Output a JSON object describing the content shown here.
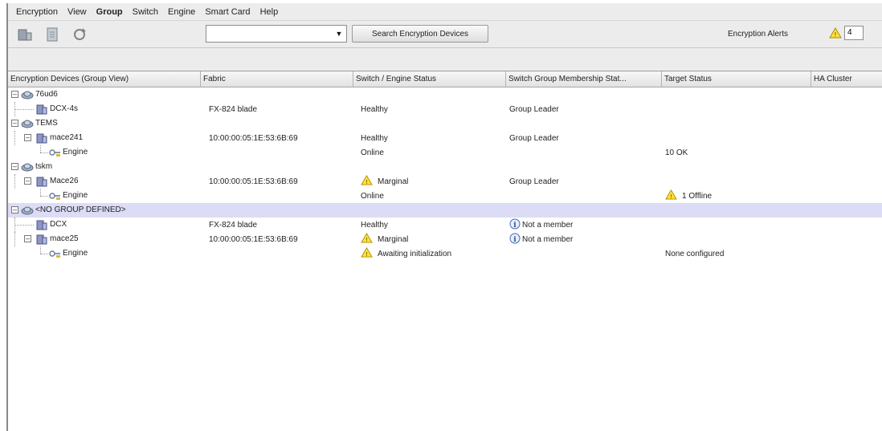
{
  "menu": [
    "Encryption",
    "View",
    "Group",
    "Switch",
    "Engine",
    "Smart Card",
    "Help"
  ],
  "search": {
    "value": "",
    "button_label": "Search Encryption Devices"
  },
  "alerts": {
    "label": "Encryption Alerts",
    "count": "4"
  },
  "columns": [
    "Encryption Devices (Group View)",
    "Fabric",
    "Switch / Engine Status",
    "Switch Group Membership Stat...",
    "Target Status",
    "HA Cluster"
  ],
  "rows": [
    {
      "label": "76ud6",
      "level": 0,
      "icon": "group-icon",
      "fabric": "",
      "status": "",
      "status_icon": "",
      "membership": "",
      "membership_icon": "",
      "target": "",
      "target_icon": ""
    },
    {
      "label": "DCX-4s",
      "level": 1,
      "icon": "switch-icon",
      "fabric": "FX-824 blade",
      "status": "Healthy",
      "status_icon": "",
      "membership": "Group Leader",
      "membership_icon": "",
      "target": "",
      "target_icon": ""
    },
    {
      "label": "TEMS",
      "level": 0,
      "icon": "group-icon",
      "fabric": "",
      "status": "",
      "status_icon": "",
      "membership": "",
      "membership_icon": "",
      "target": "",
      "target_icon": ""
    },
    {
      "label": "mace241",
      "level": 1,
      "icon": "switch-icon",
      "fabric": "10:00:00:05:1E:53:6B:69",
      "status": "Healthy",
      "status_icon": "",
      "membership": "Group Leader",
      "membership_icon": "",
      "target": "",
      "target_icon": ""
    },
    {
      "label": "Engine",
      "level": 2,
      "icon": "engine-icon",
      "fabric": "",
      "status": "Online",
      "status_icon": "",
      "membership": "",
      "membership_icon": "",
      "target": "10 OK",
      "target_icon": ""
    },
    {
      "label": "tskm",
      "level": 0,
      "icon": "group-icon",
      "fabric": "",
      "status": "",
      "status_icon": "",
      "membership": "",
      "membership_icon": "",
      "target": "",
      "target_icon": ""
    },
    {
      "label": "Mace26",
      "level": 1,
      "icon": "switch-icon",
      "fabric": "10:00:00:05:1E:53:6B:69",
      "status": "Marginal",
      "status_icon": "warning-icon",
      "membership": "Group Leader",
      "membership_icon": "",
      "target": "",
      "target_icon": ""
    },
    {
      "label": "Engine",
      "level": 2,
      "icon": "engine-icon",
      "fabric": "",
      "status": "Online",
      "status_icon": "",
      "membership": "",
      "membership_icon": "",
      "target": "1 Offline",
      "target_icon": "warning-icon"
    },
    {
      "label": "<NO GROUP DEFINED>",
      "level": 0,
      "icon": "group-icon",
      "fabric": "",
      "status": "",
      "status_icon": "",
      "membership": "",
      "membership_icon": "",
      "target": "",
      "target_icon": "",
      "selected": true
    },
    {
      "label": "DCX",
      "level": 1,
      "icon": "switch-icon",
      "fabric": "FX-824 blade",
      "status": "Healthy",
      "status_icon": "",
      "membership": "Not a member",
      "membership_icon": "info-icon",
      "target": "",
      "target_icon": ""
    },
    {
      "label": "mace25",
      "level": 1,
      "icon": "switch-icon",
      "fabric": "10:00:00:05:1E:53:6B:69",
      "status": "Marginal",
      "status_icon": "warning-icon",
      "membership": "Not a member",
      "membership_icon": "info-icon",
      "target": "",
      "target_icon": ""
    },
    {
      "label": "Engine",
      "level": 2,
      "icon": "engine-icon",
      "fabric": "",
      "status": "Awaiting initialization",
      "status_icon": "warning-icon",
      "membership": "",
      "membership_icon": "",
      "target": "None configured",
      "target_icon": ""
    }
  ]
}
